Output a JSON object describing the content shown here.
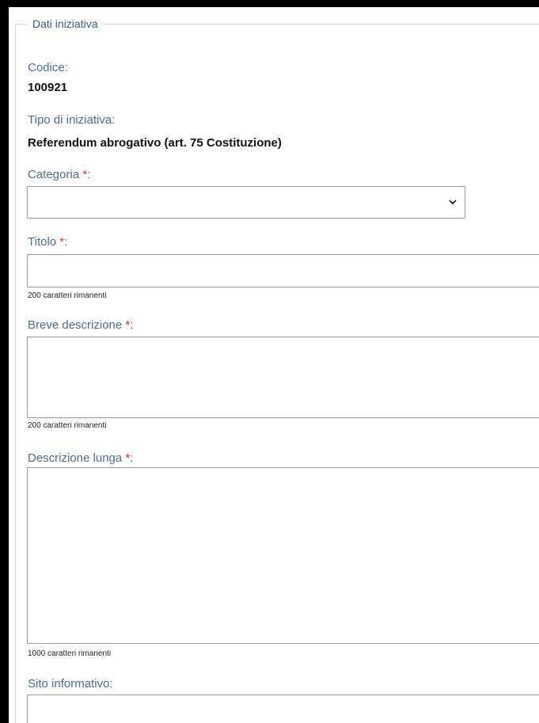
{
  "legend": "Dati iniziativa",
  "fields": {
    "codice_label": "Codice:",
    "codice_value": "100921",
    "tipo_label": "Tipo di iniziativa:",
    "tipo_value": "Referendum abrogativo (art. 75 Costituzione)",
    "categoria_label": "Categoria ",
    "categoria_value": "",
    "titolo_label": "Titolo ",
    "titolo_value": "",
    "titolo_counter": "200 caratteri rimanenti",
    "breve_label": "Breve descrizione ",
    "breve_value": "",
    "breve_counter": "200 caratteri rimanenti",
    "lunga_label": "Descrizione lunga ",
    "lunga_value": "",
    "lunga_counter": "1000 caratteri rimanenti",
    "sito_label": "Sito informativo:",
    "sito_value": ""
  },
  "required_marker": "*",
  "colon": ":",
  "colors": {
    "label": "#4c6d8e",
    "required": "#cc2f2f",
    "border": "#9a9a9a"
  },
  "icons": {
    "dropdown": "chevron-down-icon"
  }
}
